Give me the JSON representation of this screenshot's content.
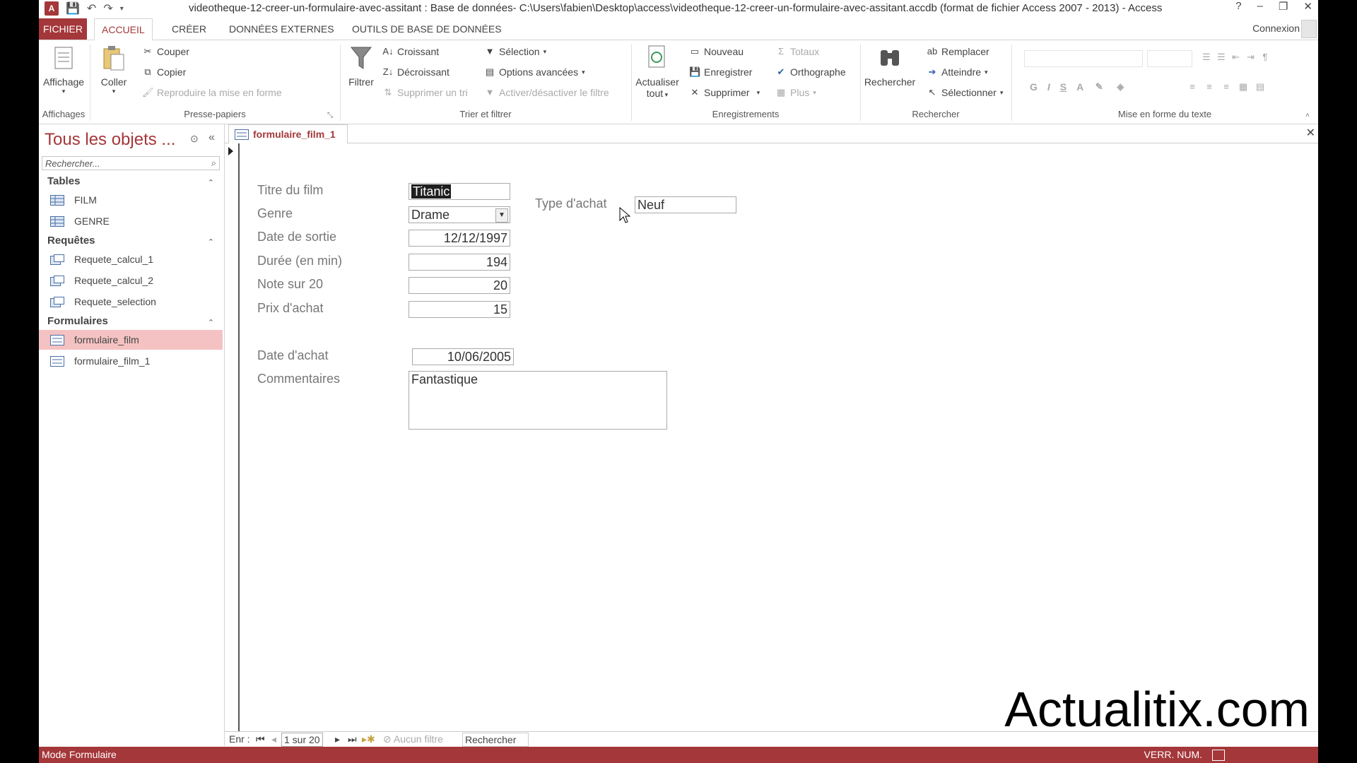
{
  "window": {
    "title": "videotheque-12-creer-un-formulaire-avec-assitant : Base de données- C:\\Users\\fabien\\Desktop\\access\\videotheque-12-creer-un-formulaire-avec-assitant.accdb (format de fichier Access 2007 - 2013) - Access",
    "help": "?",
    "minimize": "–",
    "restore": "❐",
    "close": "✕"
  },
  "tabs": [
    "FICHIER",
    "ACCUEIL",
    "CRÉER",
    "DONNÉES EXTERNES",
    "OUTILS DE BASE DE DONNÉES"
  ],
  "connexion": "Connexion",
  "ribbon": {
    "affichages": {
      "label": "Affichages",
      "affichage": "Affichage"
    },
    "presse_papiers": {
      "label": "Presse-papiers",
      "coller": "Coller",
      "couper": "Couper",
      "copier": "Copier",
      "reproduire": "Reproduire la mise en forme"
    },
    "trier": {
      "label": "Trier et filtrer",
      "filtrer": "Filtrer",
      "croissant": "Croissant",
      "decroissant": "Décroissant",
      "supprimer_tri": "Supprimer un tri",
      "selection": "Sélection",
      "options": "Options avancées",
      "activer": "Activer/désactiver le filtre"
    },
    "enregistrements": {
      "label": "Enregistrements",
      "actualiser": "Actualiser",
      "tout": "tout",
      "nouveau": "Nouveau",
      "enregistrer": "Enregistrer",
      "supprimer": "Supprimer",
      "totaux": "Totaux",
      "orthographe": "Orthographe",
      "plus": "Plus"
    },
    "rechercher": {
      "label": "Rechercher",
      "rechercher": "Rechercher",
      "remplacer": "Remplacer",
      "atteindre": "Atteindre",
      "selectionner": "Sélectionner"
    },
    "mise_en_forme": {
      "label": "Mise en forme du texte",
      "gras": "G",
      "italique": "I",
      "souligne": "S",
      "couleur": "A"
    }
  },
  "nav": {
    "title": "Tous les objets ...",
    "search_placeholder": "Rechercher...",
    "sections": [
      {
        "name": "Tables",
        "items": [
          "FILM",
          "GENRE"
        ]
      },
      {
        "name": "Requêtes",
        "items": [
          "Requete_calcul_1",
          "Requete_calcul_2",
          "Requete_selection"
        ]
      },
      {
        "name": "Formulaires",
        "items": [
          "formulaire_film",
          "formulaire_film_1"
        ]
      }
    ]
  },
  "document": {
    "tab": "formulaire_film_1",
    "fields": {
      "titre": {
        "label": "Titre du film",
        "value": "Titanic"
      },
      "genre": {
        "label": "Genre",
        "value": "Drame"
      },
      "date_sortie": {
        "label": "Date de sortie",
        "value": "12/12/1997"
      },
      "duree": {
        "label": "Durée (en min)",
        "value": "194"
      },
      "note": {
        "label": "Note sur 20",
        "value": "20"
      },
      "prix": {
        "label": "Prix d'achat",
        "value": "15"
      },
      "type_achat": {
        "label": "Type d'achat",
        "value": "Neuf"
      },
      "date_achat": {
        "label": "Date d'achat",
        "value": "10/06/2005"
      },
      "commentaires": {
        "label": "Commentaires",
        "value": "Fantastique"
      }
    }
  },
  "recnav": {
    "label": "Enr :",
    "position": "1 sur 20",
    "filter": "Aucun filtre",
    "search": "Rechercher"
  },
  "watermark": "Actualitix.com",
  "status": {
    "left": "Mode Formulaire",
    "right": "VERR. NUM."
  },
  "colors": {
    "accent": "#a4373a",
    "selected_nav": "#f4c2c2"
  }
}
